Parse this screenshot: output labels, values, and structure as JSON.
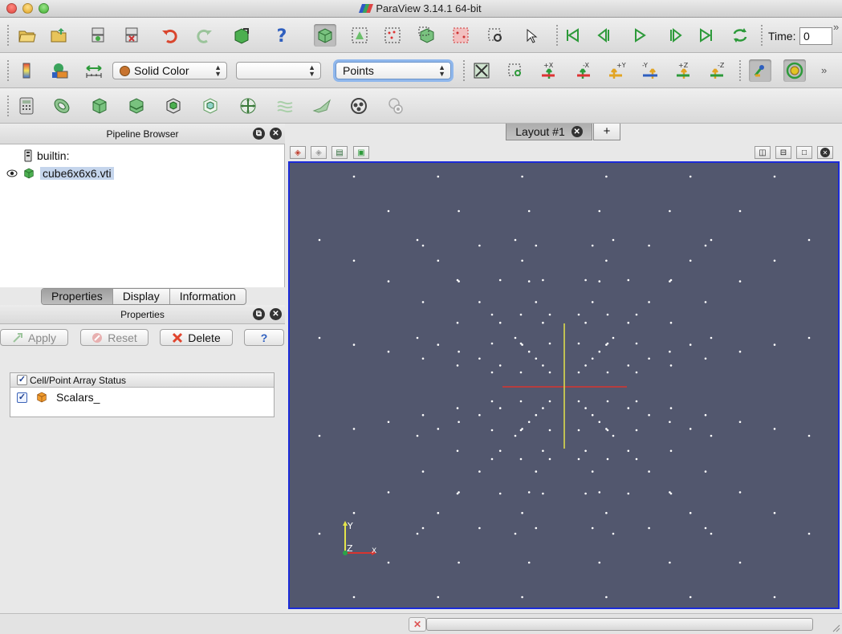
{
  "window": {
    "title": "ParaView 3.14.1 64-bit"
  },
  "toolbar_main": {
    "time_label": "Time:",
    "time_value": "0"
  },
  "toolbar_display": {
    "color_by": "Solid Color",
    "component": "",
    "representation": "Points",
    "camera_labels": {
      "px": "+X",
      "mx": "-X",
      "py": "+Y",
      "my": "-Y",
      "pz": "+Z",
      "mz": "-Z"
    }
  },
  "pipeline": {
    "title": "Pipeline Browser",
    "items": [
      {
        "label": "builtin:"
      },
      {
        "label": "cube6x6x6.vti"
      }
    ]
  },
  "panel_tabs": [
    "Properties",
    "Display",
    "Information"
  ],
  "properties": {
    "title": "Properties",
    "apply": "Apply",
    "reset": "Reset",
    "delete": "Delete",
    "help": "?",
    "array_status_header": "Cell/Point Array Status",
    "arrays": [
      {
        "name": "Scalars_"
      }
    ]
  },
  "layout": {
    "tab_label": "Layout #1",
    "add_tab": "+"
  },
  "axes": {
    "y": "Y",
    "z": "Z",
    "x": "X"
  },
  "colors": {
    "view_background": "#52576e",
    "view_border": "#1b2bd8",
    "y_axis": "#e4e44a",
    "x_axis": "#d8352f"
  }
}
